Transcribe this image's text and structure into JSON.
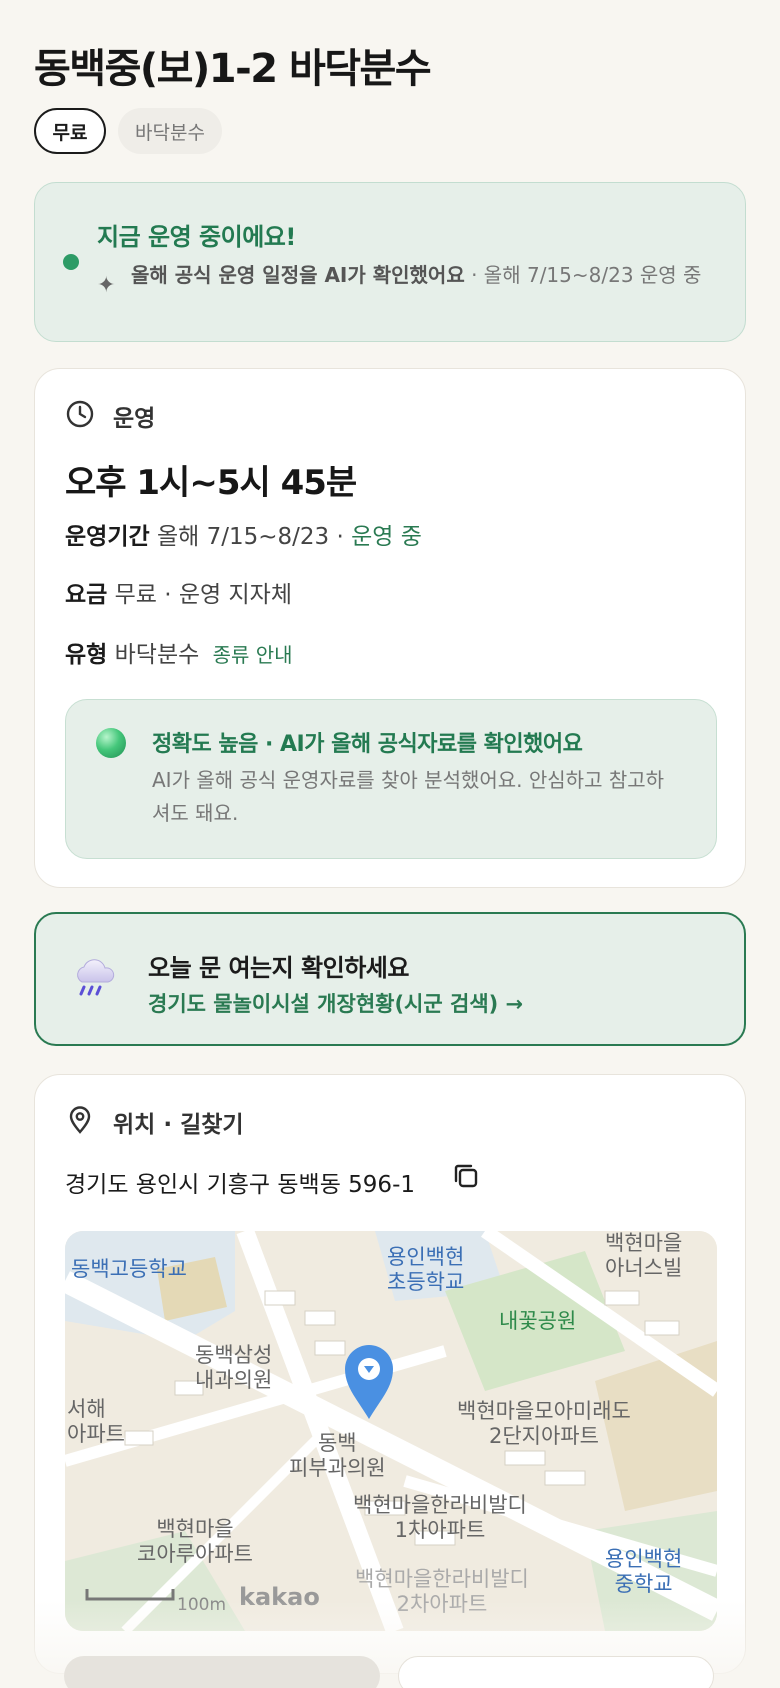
{
  "header": {
    "title": "동백중(보)1-2 바닥분수",
    "chips": [
      "무료",
      "바닥분수"
    ]
  },
  "status": {
    "title": "지금 운영 중이에요!",
    "sub_bold": "올해 공식 운영 일정을 AI가 확인했어요",
    "sub_rest": " · 올해 7/15~8/23 운영 중",
    "dot_color": "#2d9b66"
  },
  "operation": {
    "section_label": "운영",
    "section_icon": "clock-icon",
    "hours": "오후 1시~5시 45분",
    "period_label": "운영기간",
    "period_value": "올해 7/15~8/23 · ",
    "period_status": "운영 중",
    "fee_label": "요금",
    "fee_value": "무료 · 운영 지자체",
    "type_label": "유형",
    "type_value": "바닥분수",
    "type_link": "종류 안내",
    "accuracy_title": "정확도 높음 · AI가 올해 공식자료를 확인했어요",
    "accuracy_desc": "AI가 올해 공식 운영자료를 찾아 분석했어요. 안심하고 참고하셔도 돼요."
  },
  "check": {
    "icon": "rain-cloud-icon",
    "title": "오늘 문 여는지 확인하세요",
    "link": "경기도 물놀이시설 개장현황(시군 검색) →"
  },
  "location": {
    "section_label": "위치 · 길찾기",
    "section_icon": "location-pin-icon",
    "address": "경기도 용인시 기흥구 동백동 596-1",
    "copy_icon": "copy-icon",
    "map": {
      "labels": {
        "school1": "동백고등학교",
        "school2": "용인백현\n초등학교",
        "school3": "용인백현\n중학교",
        "park": "내꽃공원",
        "clinic1": "동백삼성\n내과의원",
        "clinic2": "동백\n피부과의원",
        "apt1": "백현마을모아미래도\n2단지아파트",
        "apt2": "백현마을한라비발디\n1차아파트",
        "apt3": "백현마을\n코아루아파트",
        "apt4": "백현마을한라비발디\n2차아파트",
        "apt5": "서해\n아파트",
        "apt6": "백현마을\n아너스빌"
      },
      "scale": "100m",
      "brand": "kakao"
    }
  }
}
